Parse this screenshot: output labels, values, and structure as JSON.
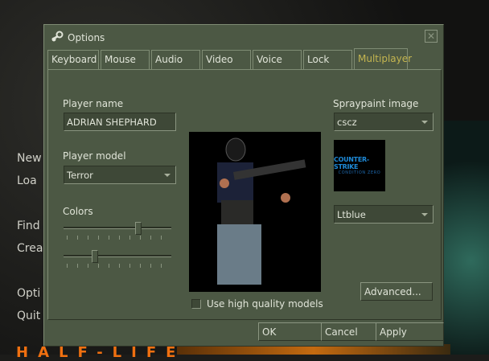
{
  "background": {
    "menu": [
      "New",
      "Loa",
      "Find",
      "Crea",
      "Opti",
      "Quit"
    ],
    "logo": "HALF-LIFE"
  },
  "dialog": {
    "title": "Options",
    "tabs": [
      "Keyboard",
      "Mouse",
      "Audio",
      "Video",
      "Voice",
      "Lock",
      "Multiplayer"
    ],
    "active_tab": "Multiplayer",
    "player_name_label": "Player name",
    "player_name": "ADRIAN SHEPHARD",
    "player_model_label": "Player model",
    "player_model": "Terror",
    "colors_label": "Colors",
    "color_slider_1": 0.71,
    "color_slider_2": 0.28,
    "spray_label": "Spraypaint image",
    "spray_value": "cscz",
    "spray_logo": {
      "line1": "COUNTER-STRIKE",
      "line2": "CONDITION ZERO"
    },
    "spray_color": "Ltblue",
    "high_quality_label": "Use high quality models",
    "high_quality_checked": false,
    "advanced": "Advanced...",
    "ok": "OK",
    "cancel": "Cancel",
    "apply": "Apply"
  },
  "colors": {
    "panel": "#4c5844",
    "accent": "#c4b550",
    "logo": "#f07010"
  }
}
